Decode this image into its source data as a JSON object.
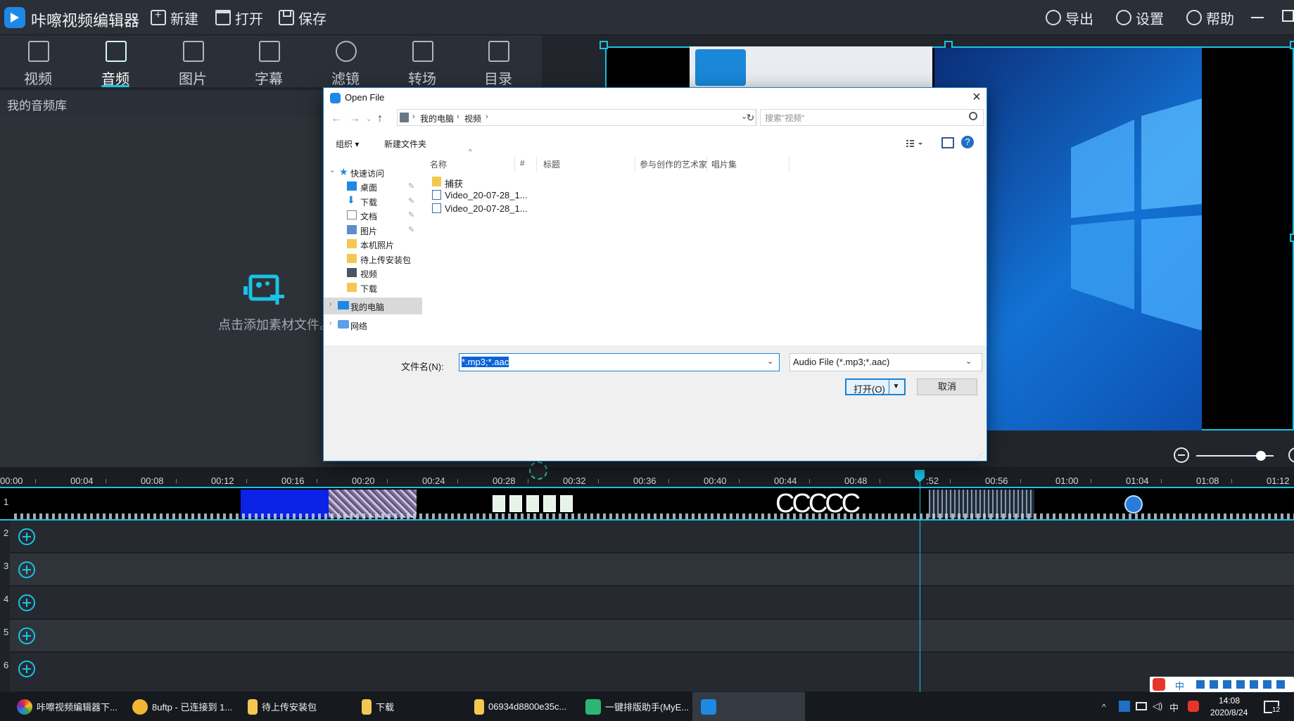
{
  "app": {
    "title": "咔嚓视频编辑器",
    "menu": {
      "new": "新建",
      "open": "打开",
      "save": "保存",
      "export": "导出",
      "settings": "设置",
      "help": "帮助"
    }
  },
  "toolbar": {
    "tabs": [
      "视频",
      "音频",
      "图片",
      "字幕",
      "滤镜",
      "转场",
      "目录"
    ],
    "active": "音频"
  },
  "library": {
    "header": "我的音频库",
    "add_hint": "点击添加素材文件。"
  },
  "dialog": {
    "title": "Open File",
    "address": [
      "我的电脑",
      "视频"
    ],
    "search_placeholder": "搜索\"视频\"",
    "organize": "组织 ▾",
    "new_folder": "新建文件夹",
    "nav": {
      "quick_access": "快速访问",
      "items": [
        "桌面",
        "下载",
        "文档",
        "图片",
        "本机照片",
        "待上传安装包",
        "视频",
        "下载"
      ],
      "this_pc": "我的电脑",
      "network": "网络"
    },
    "columns": [
      "名称",
      "#",
      "标题",
      "参与创作的艺术家",
      "唱片集"
    ],
    "files": [
      {
        "name": "捕获",
        "kind": "folder"
      },
      {
        "name": "Video_20-07-28_1...",
        "kind": "video"
      },
      {
        "name": "Video_20-07-28_1...",
        "kind": "video"
      }
    ],
    "filename_label": "文件名(N):",
    "filename_value": "*.mp3;*.aac",
    "filetype_value": "Audio File (*.mp3;*.aac)",
    "open_button": "打开(O)",
    "cancel_button": "取消"
  },
  "timeline": {
    "ticks": [
      "00:00",
      "00:04",
      "00:08",
      "00:12",
      "00:16",
      "00:20",
      "00:24",
      "00:28",
      "00:32",
      "00:36",
      "00:40",
      "00:44",
      "00:48",
      ":52",
      "00:56",
      "01:00",
      "01:04",
      "01:08",
      "01:12"
    ],
    "tracks": [
      "1",
      "2",
      "3",
      "4",
      "5",
      "6"
    ],
    "c_clip": "CCCCC"
  },
  "taskbar": {
    "items": [
      "咔嚓视频编辑器下...",
      "8uftp - 已连接到 1...",
      "待上传安装包",
      "下载",
      "06934d8800e35c...",
      "一键排版助手(MyE..."
    ],
    "tray_lang": "中",
    "time": "14:08",
    "date": "2020/8/24",
    "notify": "12"
  },
  "colors": {
    "accent": "#19c3e6",
    "dialog_accent": "#1883d7",
    "windows_blue": "#1372d4"
  }
}
